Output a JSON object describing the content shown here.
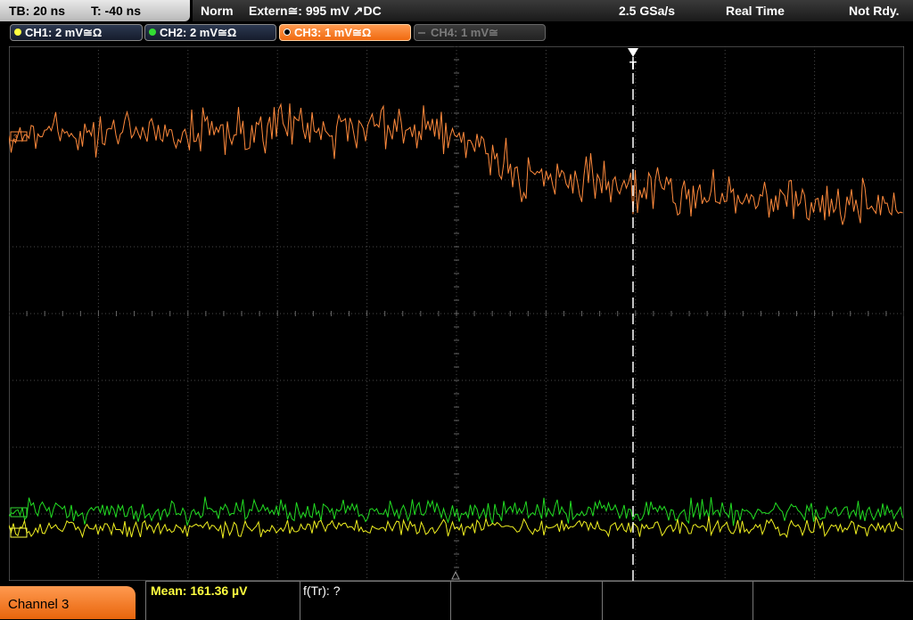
{
  "timebase": {
    "tb": "TB: 20 ns",
    "t": "T: -40 ns"
  },
  "status": {
    "mode": "Norm",
    "trigger": "Extern≅: 995 mV ↗DC",
    "sample_rate": "2.5 GSa/s",
    "acq": "Real Time",
    "ready": "Not Rdy."
  },
  "channels": [
    {
      "label": "CH1: 2 mV≅Ω",
      "color": "#ffff40"
    },
    {
      "label": "CH2: 2 mV≅Ω",
      "color": "#33dd33"
    },
    {
      "label": "CH3: 1 mV≅Ω",
      "color": "#ff8a3c"
    },
    {
      "label": "CH4: 1 mV≅",
      "color": "#666666"
    }
  ],
  "trigger_marker": "T",
  "bottom": {
    "channel_label": "Channel 3",
    "mean": "Mean: 161.36 µV",
    "ftr": "f(Tr): ?"
  },
  "colors": {
    "ch1": "#f0f020",
    "ch2": "#22dd22",
    "ch3": "#ff8a3c",
    "grid": "#4a4a4a"
  }
}
